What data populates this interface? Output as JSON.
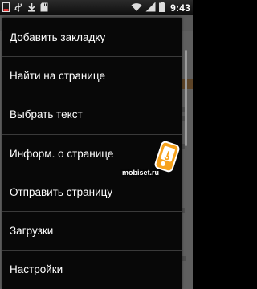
{
  "statusbar": {
    "time": "9:43",
    "icons": [
      "battery-low-icon",
      "usb-icon",
      "download-icon",
      "sd-card-icon",
      "wifi-icon",
      "signal-icon",
      "battery-icon"
    ]
  },
  "menu": {
    "items": [
      {
        "label": "Добавить закладку"
      },
      {
        "label": "Найти на странице"
      },
      {
        "label": "Выбрать текст"
      },
      {
        "label": "Информ. о странице"
      },
      {
        "label": "Отправить страницу"
      },
      {
        "label": "Загрузки"
      },
      {
        "label": "Настройки"
      }
    ]
  },
  "watermark": {
    "text": "mobiset.ru"
  },
  "colors": {
    "menu_bg": "#080808",
    "menu_text": "#ffffff",
    "accent": "#f08a00"
  }
}
